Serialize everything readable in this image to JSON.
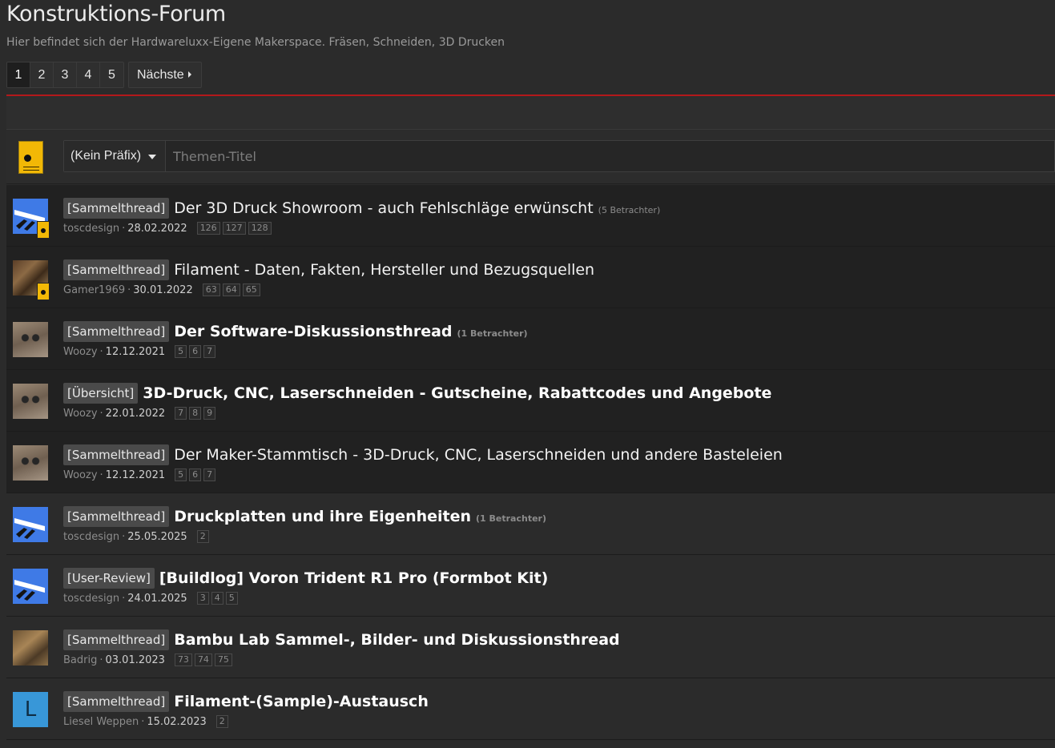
{
  "header": {
    "title": "Konstruktions-Forum",
    "description": "Hier befindet sich der Hardwareluxx-Eigene Makerspace. Fräsen, Schneiden, 3D Drucken"
  },
  "pagination": {
    "pages": [
      "1",
      "2",
      "3",
      "4",
      "5"
    ],
    "current": "1",
    "next_label": "Nächste"
  },
  "new_thread": {
    "prefix_label": "(Kein Präfix)",
    "title_placeholder": "Themen-Titel"
  },
  "colors": {
    "accent_red": "#b3181b",
    "sticky_bg": "#212121",
    "normal_bg": "#2b2b2b",
    "label_bg": "#4a4a4a"
  },
  "threads": [
    {
      "label": "[Sammelthread]",
      "title": "Der 3D Druck Showroom - auch Fehlschläge erwünscht",
      "viewers": "(5 Betrachter)",
      "author": "toscdesign",
      "date": "28.02.2022",
      "pages": [
        "126",
        "127",
        "128"
      ],
      "avatar": "toscdesign-logo",
      "sticky": true,
      "bold": false,
      "badge": true
    },
    {
      "label": "[Sammelthread]",
      "title": "Filament - Daten, Fakten, Hersteller und Bezugsquellen",
      "viewers": "",
      "author": "Gamer1969",
      "date": "30.01.2022",
      "pages": [
        "63",
        "64",
        "65"
      ],
      "avatar": "raccoon-photo",
      "sticky": true,
      "bold": false,
      "badge": true
    },
    {
      "label": "[Sammelthread]",
      "title": "Der Software-Diskussionsthread",
      "viewers": "(1 Betrachter)",
      "author": "Woozy",
      "date": "12.12.2021",
      "pages": [
        "5",
        "6",
        "7"
      ],
      "avatar": "woozy-photo",
      "sticky": true,
      "bold": true,
      "badge": false
    },
    {
      "label": "[Übersicht]",
      "title": "3D-Druck, CNC, Laserschneiden - Gutscheine, Rabattcodes und Angebote",
      "viewers": "",
      "author": "Woozy",
      "date": "22.01.2022",
      "pages": [
        "7",
        "8",
        "9"
      ],
      "avatar": "woozy-photo",
      "sticky": true,
      "bold": true,
      "badge": false
    },
    {
      "label": "[Sammelthread]",
      "title": "Der Maker-Stammtisch - 3D-Druck, CNC, Laserschneiden und andere Basteleien",
      "viewers": "",
      "author": "Woozy",
      "date": "12.12.2021",
      "pages": [
        "5",
        "6",
        "7"
      ],
      "avatar": "woozy-photo",
      "sticky": true,
      "bold": false,
      "badge": false
    },
    {
      "label": "[Sammelthread]",
      "title": "Druckplatten und ihre Eigenheiten",
      "viewers": "(1 Betrachter)",
      "author": "toscdesign",
      "date": "25.05.2025",
      "pages": [
        "2"
      ],
      "avatar": "toscdesign-logo",
      "sticky": false,
      "bold": true,
      "badge": false
    },
    {
      "label": "[User-Review]",
      "title": "[Buildlog] Voron Trident R1 Pro (Formbot Kit)",
      "viewers": "",
      "author": "toscdesign",
      "date": "24.01.2025",
      "pages": [
        "3",
        "4",
        "5"
      ],
      "avatar": "toscdesign-logo",
      "sticky": false,
      "bold": true,
      "badge": false
    },
    {
      "label": "[Sammelthread]",
      "title": "Bambu Lab Sammel-, Bilder- und Diskussionsthread",
      "viewers": "",
      "author": "Badrig",
      "date": "03.01.2023",
      "pages": [
        "73",
        "74",
        "75"
      ],
      "avatar": "badrig-photo",
      "sticky": false,
      "bold": true,
      "badge": false
    },
    {
      "label": "[Sammelthread]",
      "title": "Filament-(Sample)-Austausch",
      "viewers": "",
      "author": "Liesel Weppen",
      "date": "15.02.2023",
      "pages": [
        "2"
      ],
      "avatar": "letter-avatar",
      "avatar_letter": "L",
      "sticky": false,
      "bold": true,
      "badge": false
    }
  ]
}
